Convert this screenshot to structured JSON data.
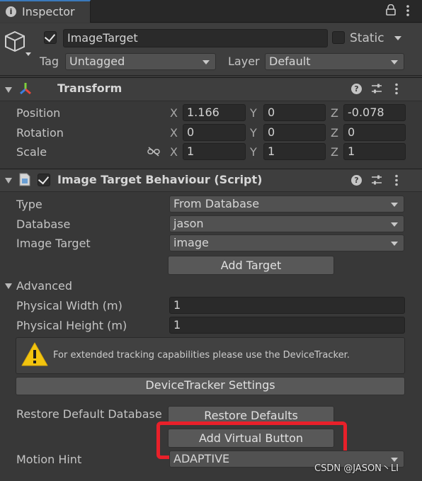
{
  "tab": {
    "label": "Inspector"
  },
  "object": {
    "name": "ImageTarget",
    "active": true,
    "static_label": "Static",
    "static_checked": false,
    "tag_label": "Tag",
    "tag_value": "Untagged",
    "layer_label": "Layer",
    "layer_value": "Default"
  },
  "transform": {
    "title": "Transform",
    "position_label": "Position",
    "rotation_label": "Rotation",
    "scale_label": "Scale",
    "axis_x": "X",
    "axis_y": "Y",
    "axis_z": "Z",
    "position": {
      "x": "1.166",
      "y": "0",
      "z": "-0.078"
    },
    "rotation": {
      "x": "0",
      "y": "0",
      "z": "0"
    },
    "scale": {
      "x": "1",
      "y": "1",
      "z": "1"
    }
  },
  "itb": {
    "title": "Image Target Behaviour (Script)",
    "enabled": true,
    "type_label": "Type",
    "type_value": "From Database",
    "database_label": "Database",
    "database_value": "jason",
    "image_target_label": "Image Target",
    "image_target_value": "image",
    "add_target": "Add Target",
    "advanced_label": "Advanced",
    "physical_width_label": "Physical Width (m)",
    "physical_width_value": "1",
    "physical_height_label": "Physical Height (m)",
    "physical_height_value": "1",
    "warning_text": "For extended tracking capabilities please use the DeviceTracker.",
    "devicetracker_button": "DeviceTracker Settings",
    "restore_label": "Restore Default Database",
    "restore_button": "Restore Defaults",
    "add_virtual_button": "Add Virtual Button",
    "motion_hint_label": "Motion Hint",
    "motion_hint_value": "ADAPTIVE"
  },
  "watermark": "CSDN @JASON丶LI",
  "colors": {
    "highlight": "#e8202a",
    "accent": "#3a79bb",
    "warning": "#f2c40f"
  }
}
